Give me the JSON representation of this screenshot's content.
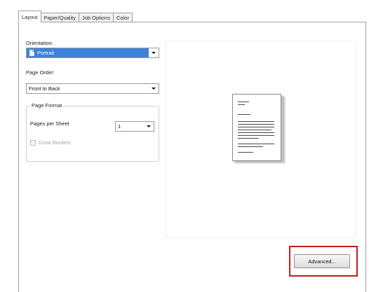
{
  "tabs": [
    {
      "label": "Layout",
      "active": true
    },
    {
      "label": "Paper/Quality",
      "active": false
    },
    {
      "label": "Job Options",
      "active": false
    },
    {
      "label": "Color",
      "active": false
    }
  ],
  "orientation": {
    "label": "Orientation:",
    "value": "Portrait",
    "icon": "portrait-page-icon"
  },
  "page_order": {
    "label": "Page Order:",
    "value": "Front to Back"
  },
  "page_format": {
    "legend": "Page Format",
    "pages_per_sheet_label": "Pages per Sheet",
    "pages_per_sheet_value": "1",
    "draw_borders_label": "Draw Borders",
    "draw_borders_checked": false,
    "draw_borders_enabled": false
  },
  "preview": {
    "icon": "document-preview-icon"
  },
  "advanced_button": {
    "label": "Advanced..."
  },
  "colors": {
    "selection": "#3e82d7",
    "highlight_border": "#c21b1b",
    "panel_border": "#a0a0a0"
  }
}
